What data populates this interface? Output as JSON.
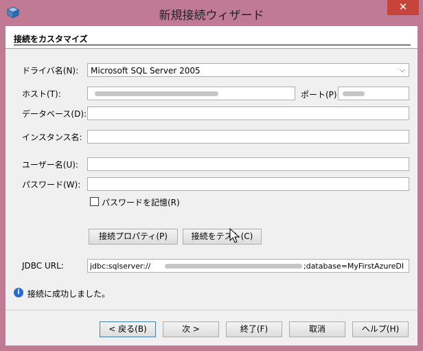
{
  "window": {
    "title": "新規接続ウィザード",
    "close_label": "✕"
  },
  "header": {
    "title": "接続をカスタマイズ"
  },
  "form": {
    "driver_label": "ドライバ名(N):",
    "driver_value": "Microsoft SQL Server 2005",
    "host_label": "ホスト(T):",
    "port_label": "ポート(P):",
    "database_label": "データベース(D):",
    "instance_label": "インスタンス名:",
    "user_label": "ユーザー名(U):",
    "password_label": "パスワード(W):",
    "remember_password_label": "パスワードを記憶(R)",
    "connection_properties_button": "接続プロパティ(P)",
    "test_connection_button": "接続をテスト(C)",
    "jdbc_label": "JDBC URL:",
    "jdbc_prefix": "jdbc:sqlserver://",
    "jdbc_suffix": ";database=MyFirstAzureDI"
  },
  "status": {
    "message": "接続に成功しました。"
  },
  "footer": {
    "back": "< 戻る(B)",
    "next": "次 >",
    "finish": "終了(F)",
    "cancel": "取消",
    "help": "ヘルプ(H)"
  }
}
